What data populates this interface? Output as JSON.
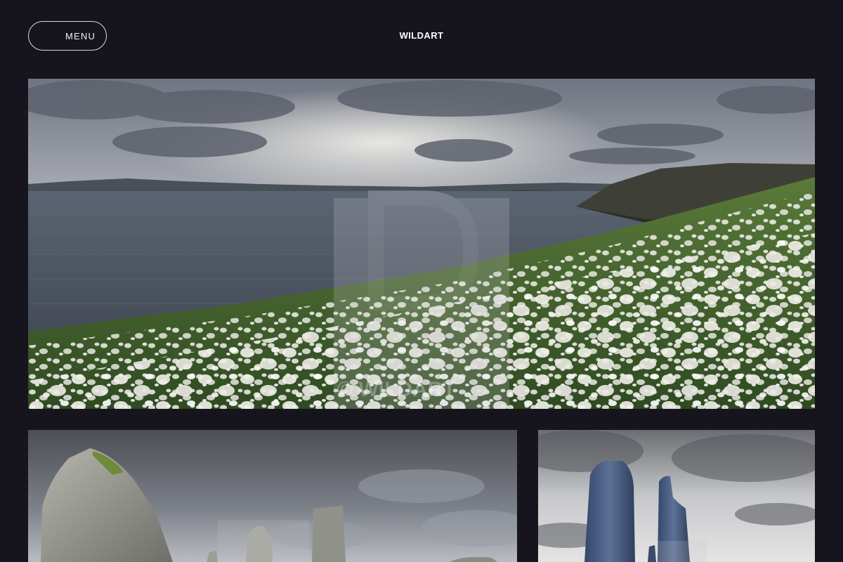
{
  "header": {
    "menu_label": "MENU",
    "site_title": "WILDART"
  },
  "gallery": {
    "hero": {
      "icon": "cotton-grass-coastal-landscape-photo",
      "watermark": "© WILDART"
    },
    "tile_left": {
      "icon": "standing-stones-photo"
    },
    "tile_right": {
      "icon": "blue-standing-stones-photo"
    }
  },
  "colors": {
    "background": "#16151d",
    "text": "#ffffff",
    "button_border": "#d8d8dc"
  }
}
